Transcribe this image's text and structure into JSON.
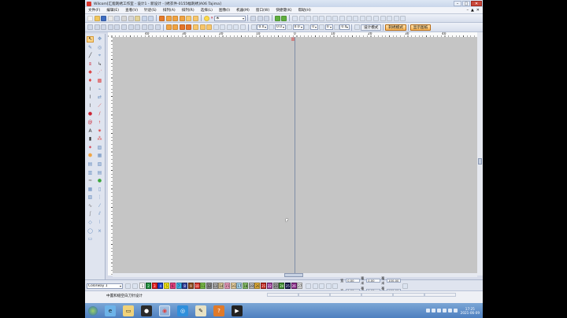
{
  "window": {
    "title": "Wilcom[汇能刺绣工作室 - 设计1 - 新设计 - [绣衣件-0155幅刺绣]A06        Tajima]",
    "min_glyph": "–",
    "max_glyph": "□",
    "close_glyph": "✕"
  },
  "menu": {
    "items": [
      "文件(F)",
      "编辑(E)",
      "查看(V)",
      "针迹(S)",
      "排列(A)",
      "排列(R)",
      "选择(L)",
      "图像(I)",
      "机器(M)",
      "窗口(W)",
      "快捷键(K)",
      "帮助(H)"
    ],
    "right_glyphs": [
      "–",
      "▲",
      "✕"
    ]
  },
  "toolbar": {
    "combo_thread": "未",
    "zero_a": "0.0",
    "zero_b": "0.0",
    "zero_c": "0.0",
    "zero_d": "0",
    "zero_e": "0",
    "zero_f": "0.0",
    "design_mode": "设计模式",
    "pattern_mode": "刺绣模式",
    "outline_btn": "显示图纸"
  },
  "ruler": {
    "ticks": [
      "40",
      "30",
      "20",
      "10",
      "0",
      "10",
      "20",
      "30",
      "40"
    ]
  },
  "canvas": {
    "origin_label": "ǁǁ"
  },
  "colorbar": {
    "palette": "Colorway 1",
    "swatches": [
      {
        "n": "1",
        "c": "#ffffff"
      },
      {
        "n": "2",
        "c": "#1f8a3a"
      },
      {
        "n": "3",
        "c": "#e32020"
      },
      {
        "n": "4",
        "c": "#1a3cc8"
      },
      {
        "n": "5",
        "c": "#f5e614"
      },
      {
        "n": "6",
        "c": "#e8407e"
      },
      {
        "n": "7",
        "c": "#3bb0e8"
      },
      {
        "n": "8",
        "c": "#2f3f9a"
      },
      {
        "n": "9",
        "c": "#8c4a1e"
      },
      {
        "n": "10",
        "c": "#d83228"
      },
      {
        "n": "11",
        "c": "#7fc64a"
      },
      {
        "n": "12",
        "c": "#8a8a8a"
      },
      {
        "n": "13",
        "c": "#b0b0b0"
      },
      {
        "n": "14",
        "c": "#d7c79a"
      },
      {
        "n": "15",
        "c": "#f4a2c2"
      },
      {
        "n": "16",
        "c": "#f2d9a6"
      },
      {
        "n": "17",
        "c": "#a9d7ef"
      },
      {
        "n": "18",
        "c": "#89c46a"
      },
      {
        "n": "19",
        "c": "#c0c0c0"
      },
      {
        "n": "20",
        "c": "#e8b23a"
      },
      {
        "n": "21",
        "c": "#c2271e"
      },
      {
        "n": "22",
        "c": "#9a3d99"
      },
      {
        "n": "23",
        "c": "#a0a0a0"
      },
      {
        "n": "24",
        "c": "#3a8a2a"
      },
      {
        "n": "25",
        "c": "#15154a"
      },
      {
        "n": "26",
        "c": "#8a2a8a"
      },
      {
        "n": "27",
        "c": "#e0e0e0"
      }
    ],
    "dims": {
      "w_label": "宽",
      "w_val": "0.00",
      "h_label": "高",
      "h_val": "0.00",
      "x_label": "毫米",
      "x_val": "0.00",
      "y_label": "毫米",
      "y_val": "0.00",
      "pct_label_1": "毫米",
      "pct_1": "100.00",
      "pct_label_2": "毫米",
      "pct_2": "100.00"
    }
  },
  "status": {
    "message": "中置和缝空白刀针设计"
  },
  "taskbar": {
    "time": "17:25",
    "date": "2021-06-09"
  },
  "colors": {
    "canvas": "#c5c5c5",
    "design_mode_bg": "#f5b253"
  }
}
